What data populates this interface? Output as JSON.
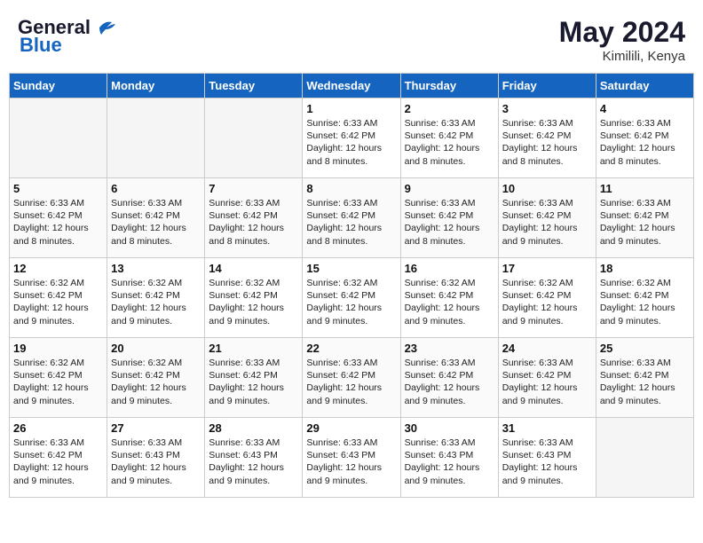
{
  "header": {
    "logo_line1": "General",
    "logo_line2": "Blue",
    "month_year": "May 2024",
    "location": "Kimilili, Kenya"
  },
  "days_of_week": [
    "Sunday",
    "Monday",
    "Tuesday",
    "Wednesday",
    "Thursday",
    "Friday",
    "Saturday"
  ],
  "weeks": [
    [
      {
        "day": "",
        "empty": true
      },
      {
        "day": "",
        "empty": true
      },
      {
        "day": "",
        "empty": true
      },
      {
        "day": "1",
        "sunrise": "6:33 AM",
        "sunset": "6:42 PM",
        "daylight": "12 hours and 8 minutes."
      },
      {
        "day": "2",
        "sunrise": "6:33 AM",
        "sunset": "6:42 PM",
        "daylight": "12 hours and 8 minutes."
      },
      {
        "day": "3",
        "sunrise": "6:33 AM",
        "sunset": "6:42 PM",
        "daylight": "12 hours and 8 minutes."
      },
      {
        "day": "4",
        "sunrise": "6:33 AM",
        "sunset": "6:42 PM",
        "daylight": "12 hours and 8 minutes."
      }
    ],
    [
      {
        "day": "5",
        "sunrise": "6:33 AM",
        "sunset": "6:42 PM",
        "daylight": "12 hours and 8 minutes."
      },
      {
        "day": "6",
        "sunrise": "6:33 AM",
        "sunset": "6:42 PM",
        "daylight": "12 hours and 8 minutes."
      },
      {
        "day": "7",
        "sunrise": "6:33 AM",
        "sunset": "6:42 PM",
        "daylight": "12 hours and 8 minutes."
      },
      {
        "day": "8",
        "sunrise": "6:33 AM",
        "sunset": "6:42 PM",
        "daylight": "12 hours and 8 minutes."
      },
      {
        "day": "9",
        "sunrise": "6:33 AM",
        "sunset": "6:42 PM",
        "daylight": "12 hours and 8 minutes."
      },
      {
        "day": "10",
        "sunrise": "6:33 AM",
        "sunset": "6:42 PM",
        "daylight": "12 hours and 9 minutes."
      },
      {
        "day": "11",
        "sunrise": "6:33 AM",
        "sunset": "6:42 PM",
        "daylight": "12 hours and 9 minutes."
      }
    ],
    [
      {
        "day": "12",
        "sunrise": "6:32 AM",
        "sunset": "6:42 PM",
        "daylight": "12 hours and 9 minutes."
      },
      {
        "day": "13",
        "sunrise": "6:32 AM",
        "sunset": "6:42 PM",
        "daylight": "12 hours and 9 minutes."
      },
      {
        "day": "14",
        "sunrise": "6:32 AM",
        "sunset": "6:42 PM",
        "daylight": "12 hours and 9 minutes."
      },
      {
        "day": "15",
        "sunrise": "6:32 AM",
        "sunset": "6:42 PM",
        "daylight": "12 hours and 9 minutes."
      },
      {
        "day": "16",
        "sunrise": "6:32 AM",
        "sunset": "6:42 PM",
        "daylight": "12 hours and 9 minutes."
      },
      {
        "day": "17",
        "sunrise": "6:32 AM",
        "sunset": "6:42 PM",
        "daylight": "12 hours and 9 minutes."
      },
      {
        "day": "18",
        "sunrise": "6:32 AM",
        "sunset": "6:42 PM",
        "daylight": "12 hours and 9 minutes."
      }
    ],
    [
      {
        "day": "19",
        "sunrise": "6:32 AM",
        "sunset": "6:42 PM",
        "daylight": "12 hours and 9 minutes."
      },
      {
        "day": "20",
        "sunrise": "6:32 AM",
        "sunset": "6:42 PM",
        "daylight": "12 hours and 9 minutes."
      },
      {
        "day": "21",
        "sunrise": "6:33 AM",
        "sunset": "6:42 PM",
        "daylight": "12 hours and 9 minutes."
      },
      {
        "day": "22",
        "sunrise": "6:33 AM",
        "sunset": "6:42 PM",
        "daylight": "12 hours and 9 minutes."
      },
      {
        "day": "23",
        "sunrise": "6:33 AM",
        "sunset": "6:42 PM",
        "daylight": "12 hours and 9 minutes."
      },
      {
        "day": "24",
        "sunrise": "6:33 AM",
        "sunset": "6:42 PM",
        "daylight": "12 hours and 9 minutes."
      },
      {
        "day": "25",
        "sunrise": "6:33 AM",
        "sunset": "6:42 PM",
        "daylight": "12 hours and 9 minutes."
      }
    ],
    [
      {
        "day": "26",
        "sunrise": "6:33 AM",
        "sunset": "6:42 PM",
        "daylight": "12 hours and 9 minutes."
      },
      {
        "day": "27",
        "sunrise": "6:33 AM",
        "sunset": "6:43 PM",
        "daylight": "12 hours and 9 minutes."
      },
      {
        "day": "28",
        "sunrise": "6:33 AM",
        "sunset": "6:43 PM",
        "daylight": "12 hours and 9 minutes."
      },
      {
        "day": "29",
        "sunrise": "6:33 AM",
        "sunset": "6:43 PM",
        "daylight": "12 hours and 9 minutes."
      },
      {
        "day": "30",
        "sunrise": "6:33 AM",
        "sunset": "6:43 PM",
        "daylight": "12 hours and 9 minutes."
      },
      {
        "day": "31",
        "sunrise": "6:33 AM",
        "sunset": "6:43 PM",
        "daylight": "12 hours and 9 minutes."
      },
      {
        "day": "",
        "empty": true
      }
    ]
  ],
  "labels": {
    "sunrise": "Sunrise:",
    "sunset": "Sunset:",
    "daylight": "Daylight:"
  }
}
